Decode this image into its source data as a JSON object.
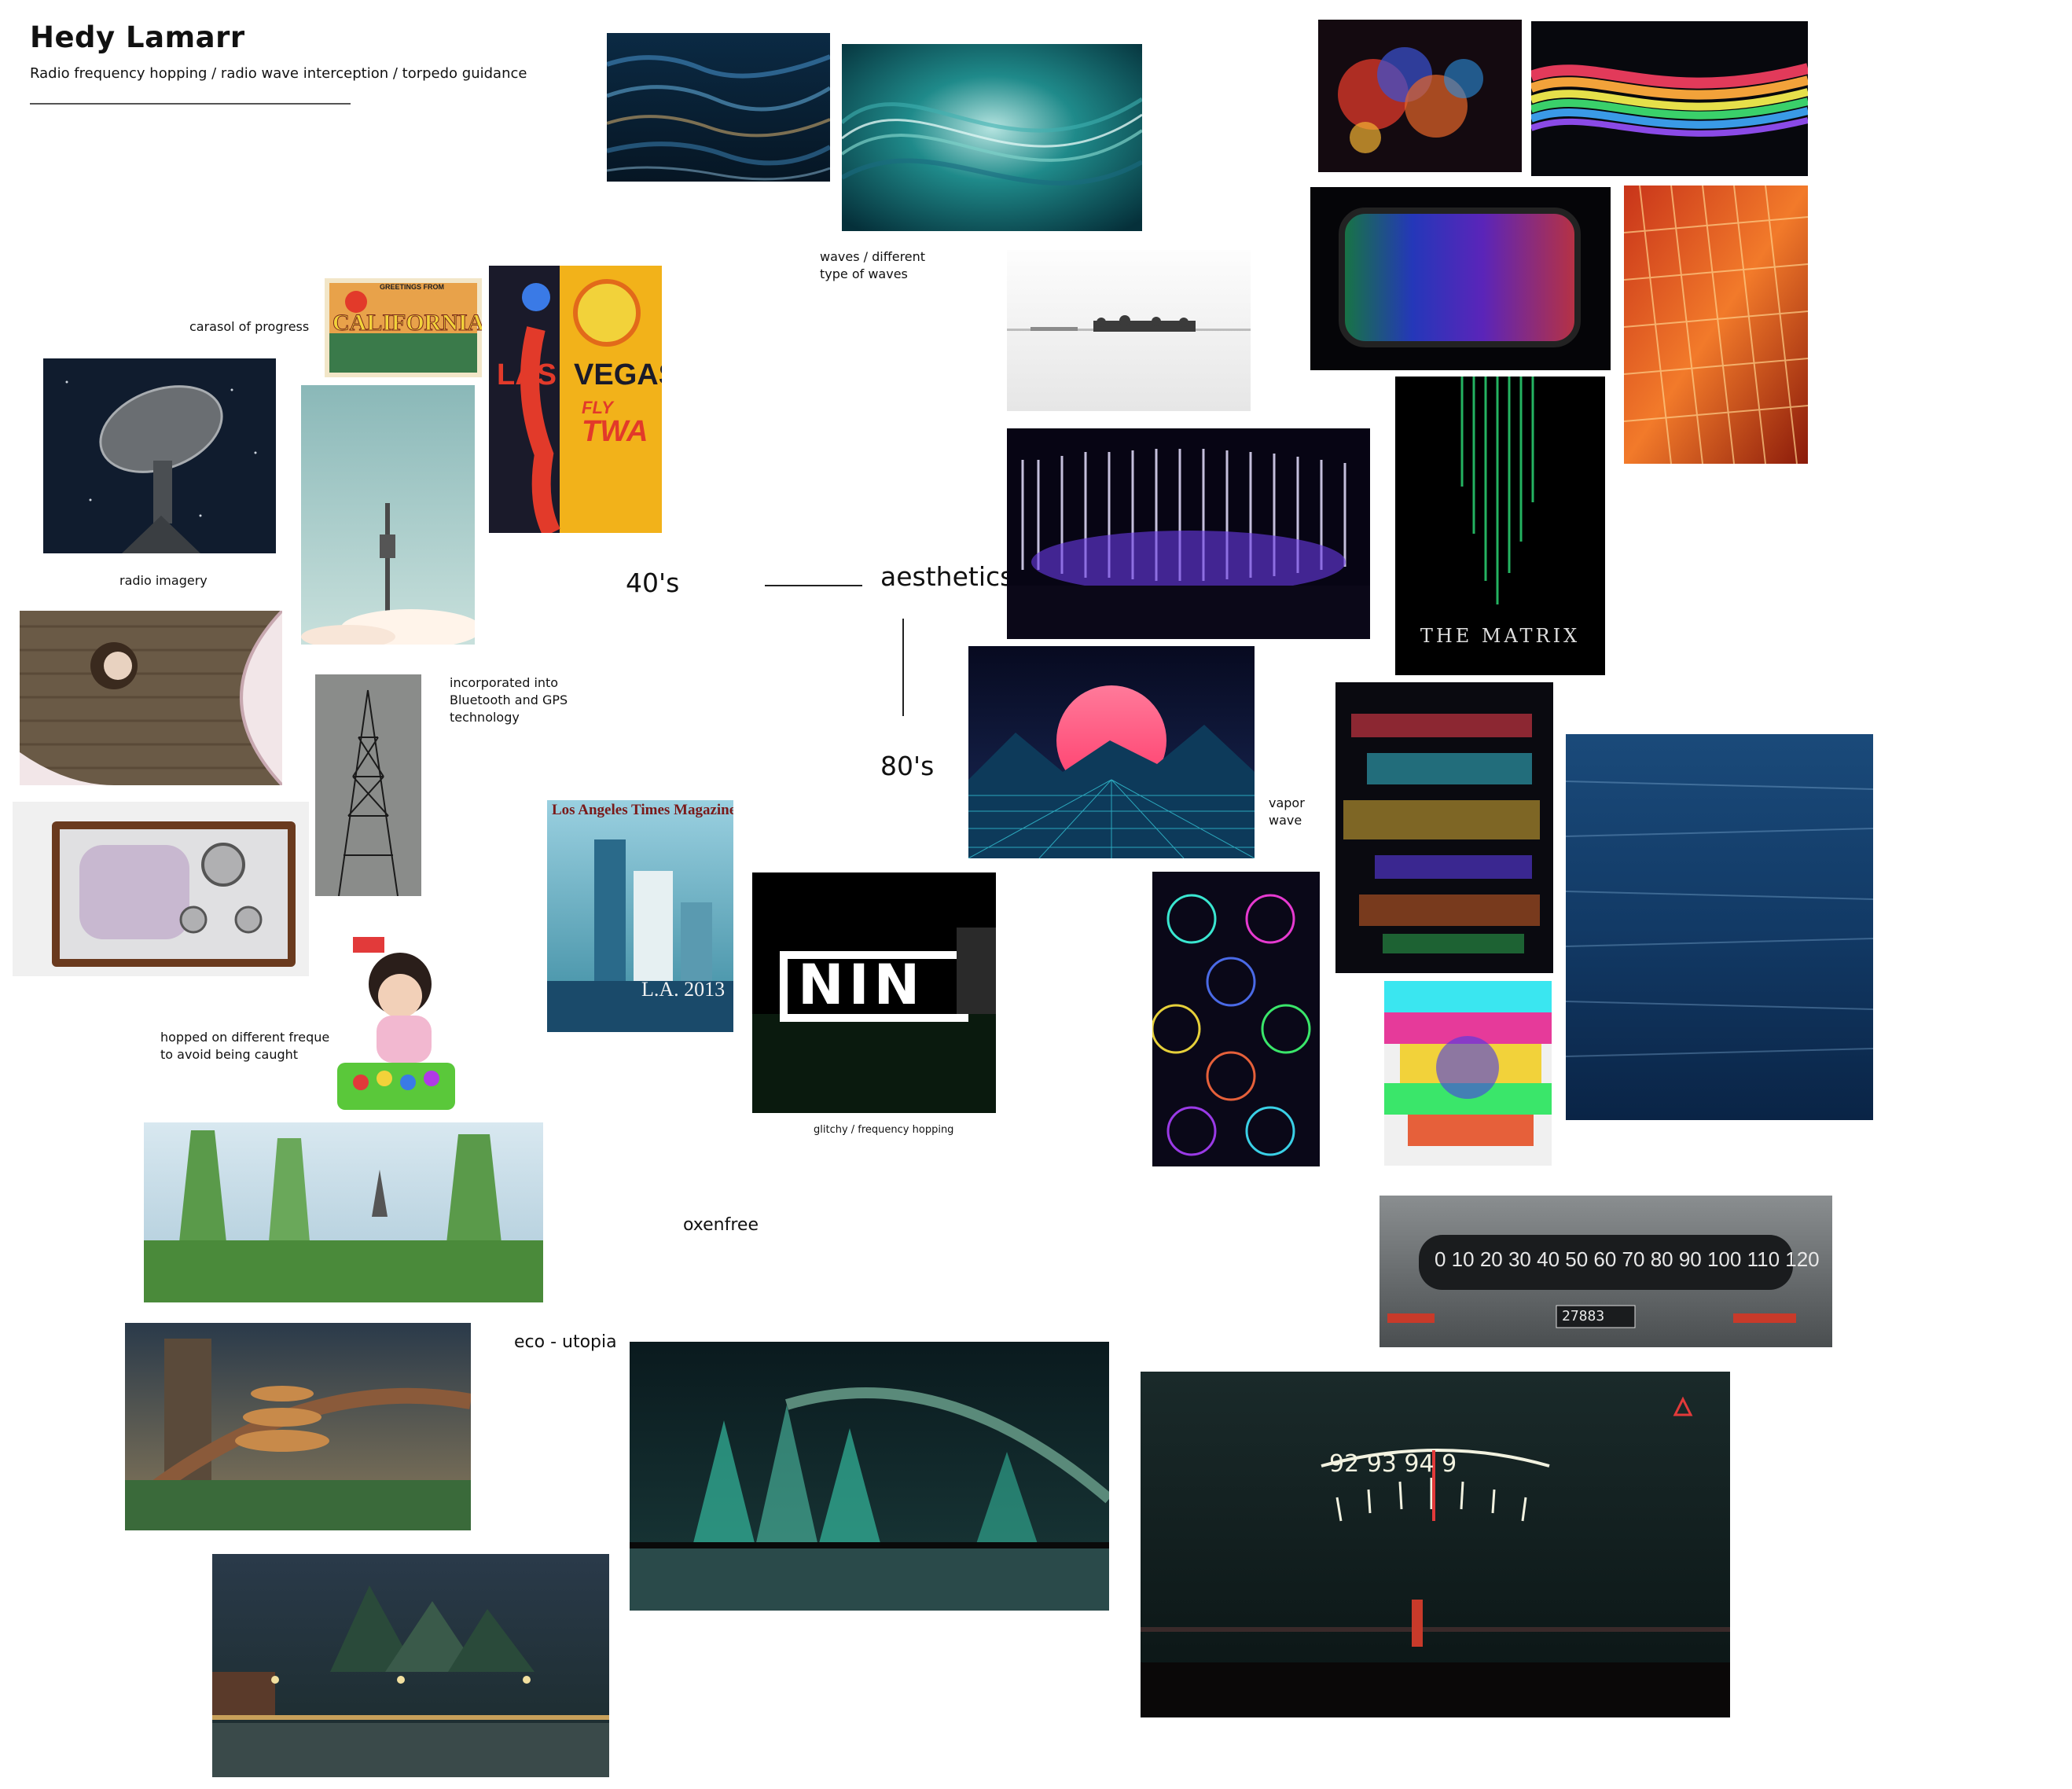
{
  "board": {
    "title": "Hedy Lamarr",
    "subtitle": "Radio frequency hopping / radio wave interception / torpedo guidance"
  },
  "labels": {
    "carousel": "carasol of progress",
    "radio_imagery": "radio imagery",
    "bluetooth": "incorporated into\nBluetooth and GPS\ntechnology",
    "hopped": "hopped on different frequer\nto avoid being caught",
    "forties": "40's",
    "aesthetics": "aesthetics",
    "eighties": "80's",
    "waves": "waves / different\ntype of waves",
    "vapor": "vapor\nwave",
    "glitchy": "glitchy / frequency hopping",
    "oxenfree": "oxenfree",
    "eco": "eco - utopia"
  },
  "image_text": {
    "california_greeting": "GREETINGS FROM",
    "california": "CALIFORNIA",
    "las": "LAS",
    "vegas": "VEGAS",
    "fly": "FLY",
    "twa": "TWA",
    "lat_masthead": "Los Angeles Times Magazine",
    "lat_title": "L.A. 2013",
    "matrix": "THE MATRIX",
    "nin": "NIN",
    "dial_numbers": "0   10   20  30  40  50  60  70  80  90  100  110   120",
    "odometer": "27883",
    "oxen_dial": "92   93   94   9"
  },
  "colors": {
    "board_background": "#ffffff",
    "text": "#111111",
    "connector": "#222222"
  }
}
